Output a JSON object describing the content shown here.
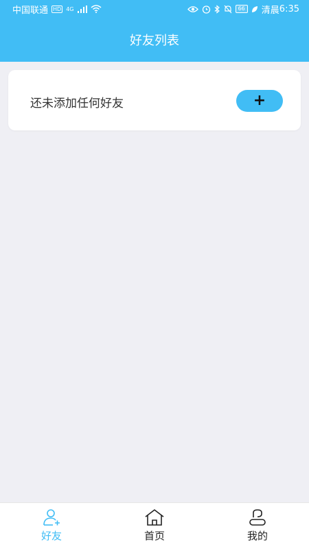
{
  "status_bar": {
    "carrier": "中国联通",
    "hd_badge": "HD",
    "network": "4G",
    "battery": "66",
    "weather": "清晨",
    "time": "6:35"
  },
  "header": {
    "title": "好友列表"
  },
  "friends": {
    "empty_text": "还未添加任何好友",
    "add_label": "+"
  },
  "tabs": [
    {
      "label": "好友",
      "icon": "add-friend-icon",
      "active": true
    },
    {
      "label": "首页",
      "icon": "home-icon",
      "active": false
    },
    {
      "label": "我的",
      "icon": "profile-icon",
      "active": false
    }
  ],
  "colors": {
    "accent": "#41bdf5",
    "background": "#efeff4"
  }
}
